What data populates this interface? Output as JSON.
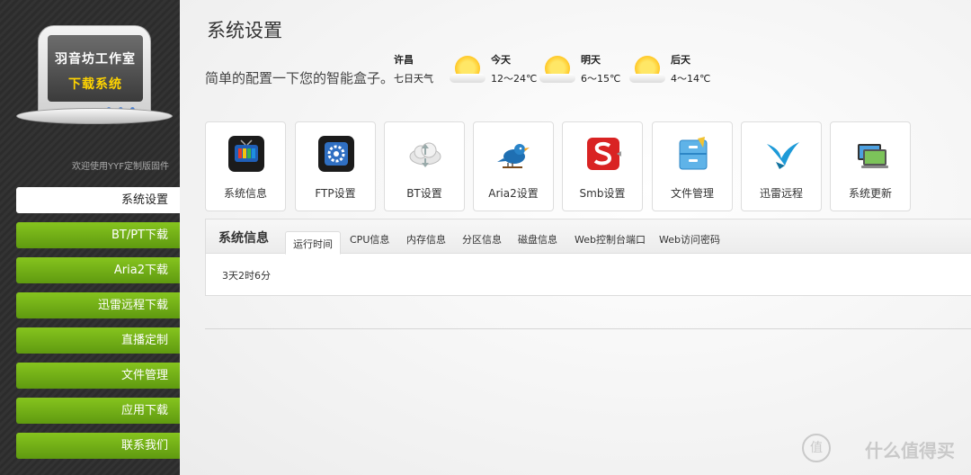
{
  "sidebar": {
    "logo_line1": "羽音坊工作室",
    "logo_line2": "下载系统",
    "welcome": "欢迎使用YYF定制版固件",
    "items": [
      {
        "label": "系统设置",
        "active": true
      },
      {
        "label": "BT/PT下载"
      },
      {
        "label": "Aria2下载"
      },
      {
        "label": "迅雷远程下载"
      },
      {
        "label": "直播定制"
      },
      {
        "label": "文件管理"
      },
      {
        "label": "应用下载"
      },
      {
        "label": "联系我们"
      }
    ]
  },
  "header": {
    "title": "系统设置",
    "subtitle": "简单的配置一下您的智能盒子。"
  },
  "weather": {
    "city": "许昌",
    "label": "七日天气",
    "days": [
      {
        "name": "今天",
        "temp": "12～24℃",
        "icon": "sunny-icon"
      },
      {
        "name": "明天",
        "temp": "6～15℃",
        "icon": "sunny-icon"
      },
      {
        "name": "后天",
        "temp": "4～14℃",
        "icon": "sunny-icon"
      }
    ]
  },
  "tiles": [
    {
      "label": "系统信息",
      "icon": "tv-info-icon"
    },
    {
      "label": "FTP设置",
      "icon": "gear-icon"
    },
    {
      "label": "BT设置",
      "icon": "cloud-icon"
    },
    {
      "label": "Aria2设置",
      "icon": "bird-icon"
    },
    {
      "label": "Smb设置",
      "icon": "smb-icon"
    },
    {
      "label": "文件管理",
      "icon": "folder-icon"
    },
    {
      "label": "迅雷远程",
      "icon": "thunder-bird-icon"
    },
    {
      "label": "系统更新",
      "icon": "update-icon"
    }
  ],
  "panel": {
    "title": "系统信息",
    "tabs": [
      "运行时间",
      "CPU信息",
      "内存信息",
      "分区信息",
      "磁盘信息",
      "Web控制台端口",
      "Web访问密码"
    ],
    "active_tab": "运行时间",
    "content": "3天2时6分"
  },
  "watermark": {
    "circle": "值",
    "text": "什么值得买"
  },
  "colors": {
    "menu_green": "#6fae14",
    "sidebar_dark": "#2c2c2c"
  }
}
